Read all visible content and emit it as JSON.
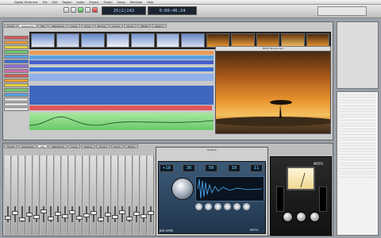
{
  "menubar": {
    "items": [
      "Digital Performer",
      "File",
      "Edit",
      "Region",
      "Audio",
      "Project",
      "Studio",
      "Setup",
      "Windows",
      "Help"
    ]
  },
  "transport": {
    "counter": "25|2|242",
    "time": "0:00:46:24"
  },
  "sequence": {
    "tabs": [
      "Tracks",
      "Sequence",
      "Mix",
      "Waveform",
      "Song",
      "Song",
      "Mixing",
      "Sound",
      "Drum",
      "Media",
      "Region"
    ],
    "video_title": "MOTU Movie.mov"
  },
  "mixer": {
    "tabs": [
      "Tracks",
      "Sequence",
      "Mix",
      "Waveform",
      "Song",
      "Mixing",
      "Sound",
      "Drum",
      "Media"
    ]
  },
  "reverb": {
    "title": "ProVerb",
    "brand": "pro verb",
    "motu": "MOTU",
    "readouts": [
      "+18",
      "36",
      "50",
      "10",
      "11"
    ]
  },
  "compressor": {
    "brand": "MOTU"
  },
  "colors": {
    "accent": "#2c9cf0",
    "track_blue": "#3a6fd8",
    "track_red": "#e05858",
    "track_green": "#7adf7a"
  }
}
